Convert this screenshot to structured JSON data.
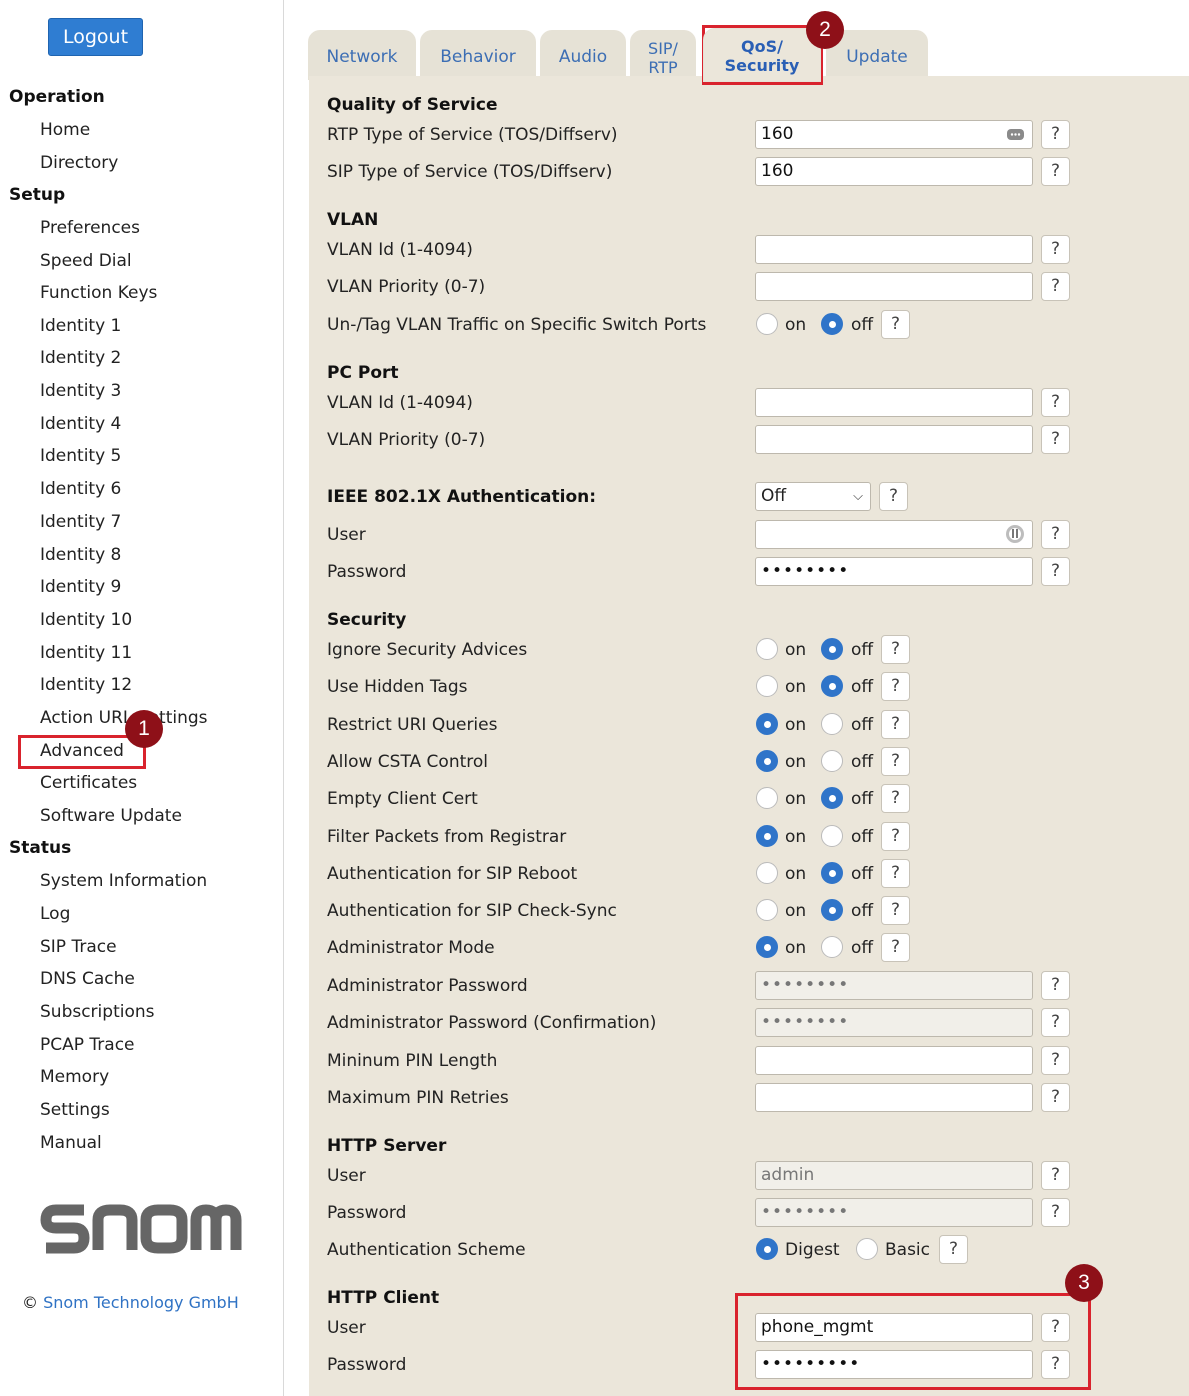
{
  "sidebar": {
    "logout": "Logout",
    "operation": {
      "heading": "Operation",
      "items": [
        "Home",
        "Directory"
      ]
    },
    "setup": {
      "heading": "Setup",
      "items": [
        "Preferences",
        "Speed Dial",
        "Function Keys",
        "Identity 1",
        "Identity 2",
        "Identity 3",
        "Identity 4",
        "Identity 5",
        "Identity 6",
        "Identity 7",
        "Identity 8",
        "Identity 9",
        "Identity 10",
        "Identity 11",
        "Identity 12",
        "Action URL Settings",
        "Advanced",
        "Certificates",
        "Software Update"
      ]
    },
    "status": {
      "heading": "Status",
      "items": [
        "System Information",
        "Log",
        "SIP Trace",
        "DNS Cache",
        "Subscriptions",
        "PCAP Trace",
        "Memory",
        "Settings",
        "Manual"
      ]
    },
    "logo": "snom",
    "copyright_symbol": "©",
    "copyright_link": "Snom Technology GmbH"
  },
  "tabs": [
    {
      "line1": "Network",
      "line2": ""
    },
    {
      "line1": "Behavior",
      "line2": ""
    },
    {
      "line1": "Audio",
      "line2": ""
    },
    {
      "line1": "SIP/",
      "line2": "RTP"
    },
    {
      "line1": "QoS/",
      "line2": "Security",
      "active": true
    },
    {
      "line1": "Update",
      "line2": ""
    }
  ],
  "badges": [
    "1",
    "2",
    "3"
  ],
  "help_label": "?",
  "radio_labels": {
    "on": "on",
    "off": "off",
    "digest": "Digest",
    "basic": "Basic"
  },
  "qos": {
    "heading": "Quality of Service",
    "rtp_tos": {
      "label": "RTP Type of Service (TOS/Diffserv)",
      "value": "160"
    },
    "sip_tos": {
      "label": "SIP Type of Service (TOS/Diffserv)",
      "value": "160"
    }
  },
  "vlan": {
    "heading": "VLAN",
    "id": {
      "label": "VLAN Id (1-4094)",
      "value": ""
    },
    "priority": {
      "label": "VLAN Priority (0-7)",
      "value": ""
    },
    "untag": {
      "label": "Un-/Tag VLAN Traffic on Specific Switch Ports",
      "selected": "off"
    }
  },
  "pc_port": {
    "heading": "PC Port",
    "id": {
      "label": "VLAN Id (1-4094)",
      "value": ""
    },
    "priority": {
      "label": "VLAN Priority (0-7)",
      "value": ""
    }
  },
  "ieee": {
    "heading": "IEEE 802.1X Authentication:",
    "selected": "Off",
    "user": {
      "label": "User",
      "value": ""
    },
    "password": {
      "label": "Password",
      "value": "••••••••"
    }
  },
  "security": {
    "heading": "Security",
    "toggles": [
      {
        "label": "Ignore Security Advices",
        "selected": "off"
      },
      {
        "label": "Use Hidden Tags",
        "selected": "off"
      },
      {
        "label": "Restrict URI Queries",
        "selected": "on"
      },
      {
        "label": "Allow CSTA Control",
        "selected": "on"
      },
      {
        "label": "Empty Client Cert",
        "selected": "off"
      },
      {
        "label": "Filter Packets from Registrar",
        "selected": "on"
      },
      {
        "label": "Authentication for SIP Reboot",
        "selected": "off"
      },
      {
        "label": "Authentication for SIP Check-Sync",
        "selected": "off"
      },
      {
        "label": "Administrator Mode",
        "selected": "on"
      }
    ],
    "admin_password": {
      "label": "Administrator Password",
      "value": "••••••••"
    },
    "admin_password_confirm": {
      "label": "Administrator Password (Confirmation)",
      "value": "••••••••"
    },
    "min_pin": {
      "label": "Mininum PIN Length",
      "value": ""
    },
    "max_pin_retries": {
      "label": "Maximum PIN Retries",
      "value": ""
    }
  },
  "http_server": {
    "heading": "HTTP Server",
    "user": {
      "label": "User",
      "value": "admin"
    },
    "password": {
      "label": "Password",
      "value": "••••••••"
    },
    "scheme": {
      "label": "Authentication Scheme",
      "selected": "Digest"
    }
  },
  "http_client": {
    "heading": "HTTP Client",
    "user": {
      "label": "User",
      "value": "phone_mgmt"
    },
    "password": {
      "label": "Password",
      "value": "•••••••••"
    }
  },
  "colors": {
    "accent": "#2f74c9",
    "panel": "#ebe6da",
    "highlight": "#d9232d",
    "badge": "#8e1018"
  }
}
